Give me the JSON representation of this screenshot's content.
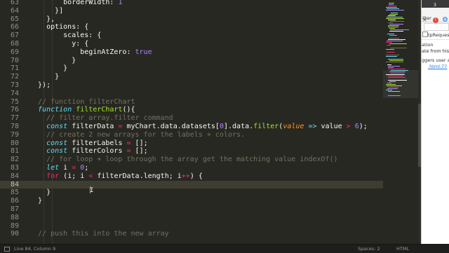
{
  "editor": {
    "lines": [
      {
        "num": "63",
        "tokens": [
          [
            "prop",
            "        borderWidth: "
          ],
          [
            "num",
            "1"
          ]
        ]
      },
      {
        "num": "64",
        "tokens": [
          [
            "prop",
            "      }]"
          ]
        ]
      },
      {
        "num": "65",
        "tokens": [
          [
            "prop",
            "    },"
          ]
        ]
      },
      {
        "num": "66",
        "tokens": [
          [
            "prop",
            "    options: {"
          ]
        ]
      },
      {
        "num": "67",
        "tokens": [
          [
            "prop",
            "        scales: {"
          ]
        ]
      },
      {
        "num": "68",
        "tokens": [
          [
            "prop",
            "          y: {"
          ]
        ]
      },
      {
        "num": "69",
        "tokens": [
          [
            "prop",
            "            beginAtZero: "
          ],
          [
            "num",
            "true"
          ]
        ]
      },
      {
        "num": "70",
        "tokens": [
          [
            "prop",
            "          }"
          ]
        ]
      },
      {
        "num": "71",
        "tokens": [
          [
            "prop",
            "        }"
          ]
        ]
      },
      {
        "num": "72",
        "tokens": [
          [
            "prop",
            "      }"
          ]
        ]
      },
      {
        "num": "73",
        "tokens": [
          [
            "prop",
            "  });"
          ]
        ]
      },
      {
        "num": "74",
        "tokens": []
      },
      {
        "num": "75",
        "tokens": [
          [
            "cm",
            "  // function filterChart"
          ]
        ]
      },
      {
        "num": "76",
        "tokens": [
          [
            "prop",
            "  "
          ],
          [
            "kw",
            "function"
          ],
          [
            "prop",
            " "
          ],
          [
            "fn",
            "filterChart"
          ],
          [
            "prop",
            "(){"
          ]
        ]
      },
      {
        "num": "77",
        "tokens": [
          [
            "cm",
            "    // filter array.filter command"
          ]
        ]
      },
      {
        "num": "78",
        "tokens": [
          [
            "prop",
            "    "
          ],
          [
            "kw",
            "const"
          ],
          [
            "prop",
            " filterData "
          ],
          [
            "op",
            "="
          ],
          [
            "prop",
            " myChart.data.datasets["
          ],
          [
            "num",
            "0"
          ],
          [
            "prop",
            "].data."
          ],
          [
            "fn",
            "filter"
          ],
          [
            "prop",
            "("
          ],
          [
            "prm",
            "value"
          ],
          [
            "prop",
            " "
          ],
          [
            "kw",
            "=>"
          ],
          [
            "prop",
            " value "
          ],
          [
            "op",
            ">"
          ],
          [
            "prop",
            " "
          ],
          [
            "num",
            "6"
          ],
          [
            "prop",
            ");"
          ]
        ]
      },
      {
        "num": "79",
        "tokens": [
          [
            "cm",
            "    // create 2 new arrays for the labels + colors."
          ]
        ]
      },
      {
        "num": "80",
        "tokens": [
          [
            "prop",
            "    "
          ],
          [
            "kw",
            "const"
          ],
          [
            "prop",
            " filterLabels "
          ],
          [
            "op",
            "="
          ],
          [
            "prop",
            " [];"
          ]
        ]
      },
      {
        "num": "81",
        "tokens": [
          [
            "prop",
            "    "
          ],
          [
            "kw",
            "const"
          ],
          [
            "prop",
            " filterColors "
          ],
          [
            "op",
            "="
          ],
          [
            "prop",
            " [];"
          ]
        ]
      },
      {
        "num": "82",
        "tokens": [
          [
            "cm",
            "    // for loop + loop through the array get the matching value indexOf()"
          ]
        ]
      },
      {
        "num": "83",
        "tokens": [
          [
            "prop",
            "    "
          ],
          [
            "kw",
            "let"
          ],
          [
            "prop",
            " i "
          ],
          [
            "op",
            "="
          ],
          [
            "prop",
            " "
          ],
          [
            "num",
            "0"
          ],
          [
            "prop",
            ";"
          ]
        ]
      },
      {
        "num": "84",
        "tokens": [
          [
            "prop",
            "    "
          ],
          [
            "op",
            "for"
          ],
          [
            "prop",
            " (i; i "
          ],
          [
            "op",
            "<"
          ],
          [
            "prop",
            " filterData.length; i"
          ],
          [
            "op",
            "++"
          ],
          [
            "prop",
            ") {"
          ]
        ]
      },
      {
        "num": "84",
        "tokens": []
      },
      {
        "num": "85",
        "tokens": [
          [
            "prop",
            "    }"
          ]
        ]
      },
      {
        "num": "86",
        "tokens": [
          [
            "prop",
            "  }"
          ]
        ]
      },
      {
        "num": "87",
        "tokens": []
      },
      {
        "num": "88",
        "tokens": []
      },
      {
        "num": "89",
        "tokens": []
      },
      {
        "num": "90",
        "tokens": [
          [
            "cm",
            "  // push this into the new array"
          ]
        ]
      }
    ],
    "current_line_index": 22
  },
  "devtools": {
    "error_count": "3",
    "tab_fragment": "ilter",
    "rows": [
      "tpRequests",
      "",
      "ation",
      "",
      "ate from histor",
      "",
      "ggers user acti",
      ""
    ],
    "link": ".html:77"
  },
  "statusbar": {
    "position": "Line 84, Column 9",
    "spaces": "Spaces: 2",
    "syntax": "HTML"
  },
  "colors": {
    "background": "#272822",
    "keyword": "#66d9ef",
    "function": "#a6e22e",
    "number": "#ae81ff",
    "operator": "#f92672",
    "comment": "#75715e",
    "parameter": "#fd971f"
  }
}
